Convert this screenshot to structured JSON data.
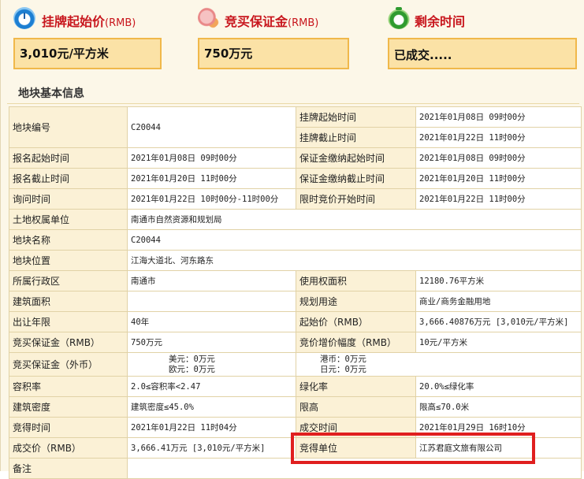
{
  "summary": {
    "start_price": {
      "title": "挂牌起始价",
      "unit": "(RMB)",
      "value": "3,010元/平方米",
      "icon": "clock-icon"
    },
    "deposit": {
      "title": "竞买保证金",
      "unit": "(RMB)",
      "value": "750万元",
      "icon": "piggy-bank-icon"
    },
    "remaining": {
      "title": "剩余时间",
      "value": "已成交.....",
      "icon": "alarm-clock-icon"
    }
  },
  "section_title": "地块基本信息",
  "table": {
    "plot_no": {
      "label": "地块编号",
      "value": "C20044"
    },
    "list_start": {
      "label": "挂牌起始时间",
      "value": "2021年01月08日 09时00分"
    },
    "list_end": {
      "label": "挂牌截止时间",
      "value": "2021年01月22日 11时00分"
    },
    "reg_start": {
      "label": "报名起始时间",
      "value": "2021年01月08日 09时00分"
    },
    "dep_start": {
      "label": "保证金缴纳起始时间",
      "value": "2021年01月08日 09时00分"
    },
    "reg_end": {
      "label": "报名截止时间",
      "value": "2021年01月20日 11时00分"
    },
    "dep_end": {
      "label": "保证金缴纳截止时间",
      "value": "2021年01月20日 11时00分"
    },
    "inquiry": {
      "label": "询问时间",
      "value": "2021年01月22日 10时00分-11时00分"
    },
    "timed_bid": {
      "label": "限时竞价开始时间",
      "value": "2021年01月22日 11时00分"
    },
    "owner": {
      "label": "土地权属单位",
      "value": "南通市自然资源和规划局"
    },
    "plot_name": {
      "label": "地块名称",
      "value": "C20044"
    },
    "location": {
      "label": "地块位置",
      "value": "江海大道北、河东路东"
    },
    "district": {
      "label": "所属行政区",
      "value": "南通市"
    },
    "use_area": {
      "label": "使用权面积",
      "value": "12180.76平方米"
    },
    "building_area": {
      "label": "建筑面积",
      "value": ""
    },
    "purpose": {
      "label": "规划用途",
      "value": "商业/商务金融用地"
    },
    "term": {
      "label": "出让年限",
      "value": "40年"
    },
    "start_price": {
      "label": "起始价（RMB）",
      "value": "3,666.40876万元 [3,010元/平方米]"
    },
    "deposit_rmb": {
      "label": "竞买保证金（RMB）",
      "value": "750万元"
    },
    "increment": {
      "label": "竞价增价幅度（RMB）",
      "value": "10元/平方米"
    },
    "deposit_fx": {
      "label": "竞买保证金（外币）",
      "usd": "美元：0万元",
      "eur": "欧元：0万元",
      "hkd": "港币：0万元",
      "jpy": "日元：0万元"
    },
    "far": {
      "label": "容积率",
      "value": "2.0≤容积率<2.47"
    },
    "green": {
      "label": "绿化率",
      "value": "20.0%≤绿化率"
    },
    "density": {
      "label": "建筑密度",
      "value": "建筑密度≤45.0%"
    },
    "height": {
      "label": "限高",
      "value": "限高≤70.0米"
    },
    "win_time": {
      "label": "竞得时间",
      "value": "2021年01月22日 11时04分"
    },
    "deal_time": {
      "label": "成交时间",
      "value": "2021年01月29日 16时10分"
    },
    "deal_price": {
      "label": "成交价（RMB）",
      "value": "3,666.41万元 [3,010元/平方米]"
    },
    "winner": {
      "label": "竞得单位",
      "value": "江苏君庭文旅有限公司"
    },
    "remarks": {
      "label": "备注",
      "value": ""
    }
  },
  "colors": {
    "title_red": "#c8161d",
    "box_fill": "#fbe2a6",
    "box_border": "#f0b84a",
    "highlight": "#e01f1f"
  }
}
